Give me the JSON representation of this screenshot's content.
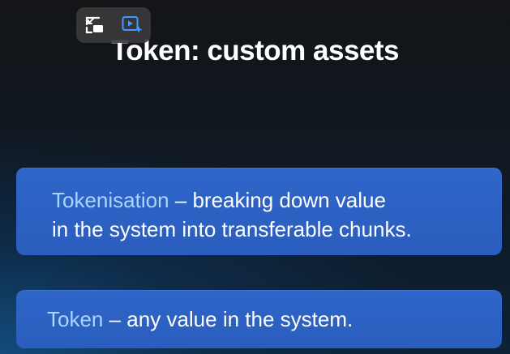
{
  "controls": {
    "pip_icon": "picture-in-picture-icon",
    "ai_video_icon": "ai-video-icon"
  },
  "slide": {
    "title": "Token: custom assets",
    "cards": [
      {
        "term": "Tokenisation",
        "line1_rest": " – breaking down value",
        "line2": "in the system into transferable chunks."
      },
      {
        "term": "Token",
        "rest": " – any value in the system."
      }
    ]
  },
  "colors": {
    "card_bg": "#2f66c9",
    "term_text": "#a8d6ff",
    "title_text": "#ffffff"
  }
}
